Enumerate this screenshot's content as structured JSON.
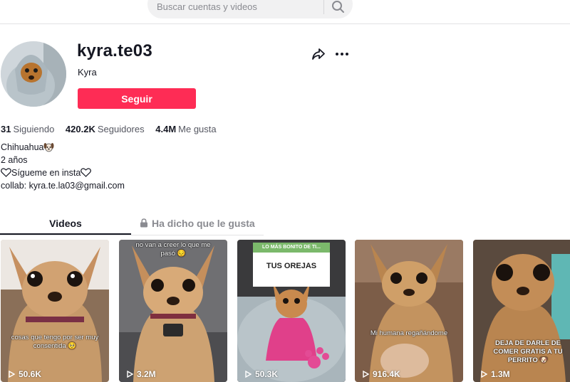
{
  "search": {
    "placeholder": "Buscar cuentas y videos"
  },
  "profile": {
    "username": "kyra.te03",
    "nickname": "Kyra",
    "follow_label": "Seguir"
  },
  "stats": {
    "following_count": "31",
    "following_label": "Siguiendo",
    "followers_count": "420.2K",
    "followers_label": "Seguidores",
    "likes_count": "4.4M",
    "likes_label": "Me gusta"
  },
  "bio": {
    "line1": "Chihuahua",
    "line2": "2 años",
    "line3": "Sígueme en insta",
    "line4": "collab: kyra.te.la03@gmail.com"
  },
  "tabs": {
    "videos": "Videos",
    "liked": "Ha dicho que le gusta"
  },
  "videos": [
    {
      "views": "50.6K",
      "caption": "cosas que tengo por ser muy consentida 🥺"
    },
    {
      "views": "3.2M",
      "caption": "no van a creer lo que me pasó 😔"
    },
    {
      "views": "50.3K",
      "sign_top": "LO MÁS BONITO DE TI...",
      "sign_main": "TUS OREJAS"
    },
    {
      "views": "916.4K",
      "caption": "Mi humana regañándome"
    },
    {
      "views": "1.3M",
      "caption": "DEJA DE DARLE DE COMER GRATIS A TU PERRITO 🐶"
    }
  ],
  "colors": {
    "accent": "#fe2c55",
    "text": "#161823",
    "muted": "#8a8b91"
  }
}
